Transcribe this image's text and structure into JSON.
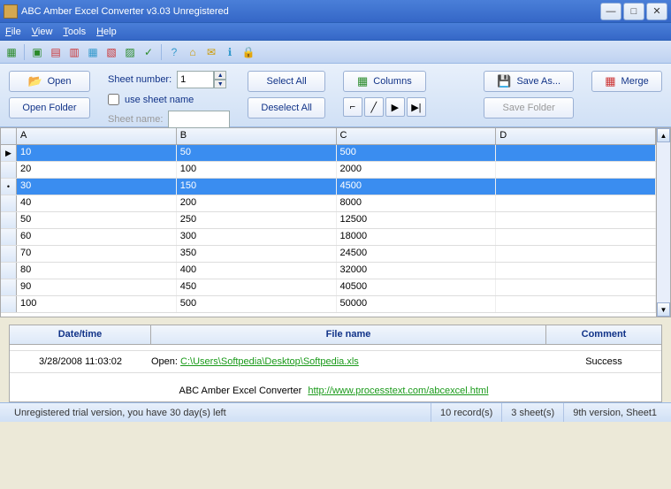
{
  "window": {
    "title": "ABC Amber Excel Converter v3.03 Unregistered"
  },
  "menu": {
    "file": "File",
    "view": "View",
    "tools": "Tools",
    "help": "Help"
  },
  "controls": {
    "open": "Open",
    "open_folder": "Open Folder",
    "sheet_number_label": "Sheet number:",
    "sheet_number_value": "1",
    "use_sheet_name_label": "use sheet name",
    "sheet_name_label": "Sheet name:",
    "sheet_name_value": "",
    "select_all": "Select All",
    "deselect_all": "Deselect All",
    "columns": "Columns",
    "save_as": "Save As...",
    "save_folder": "Save Folder",
    "merge": "Merge"
  },
  "grid": {
    "columns": [
      "A",
      "B",
      "C",
      "D"
    ],
    "rows": [
      {
        "a": "10",
        "b": "50",
        "c": "500",
        "d": "",
        "selected": true,
        "marker": "▶"
      },
      {
        "a": "20",
        "b": "100",
        "c": "2000",
        "d": "",
        "selected": false,
        "marker": ""
      },
      {
        "a": "30",
        "b": "150",
        "c": "4500",
        "d": "",
        "selected": true,
        "marker": "•"
      },
      {
        "a": "40",
        "b": "200",
        "c": "8000",
        "d": "",
        "selected": false,
        "marker": ""
      },
      {
        "a": "50",
        "b": "250",
        "c": "12500",
        "d": "",
        "selected": false,
        "marker": ""
      },
      {
        "a": "60",
        "b": "300",
        "c": "18000",
        "d": "",
        "selected": false,
        "marker": ""
      },
      {
        "a": "70",
        "b": "350",
        "c": "24500",
        "d": "",
        "selected": false,
        "marker": ""
      },
      {
        "a": "80",
        "b": "400",
        "c": "32000",
        "d": "",
        "selected": false,
        "marker": ""
      },
      {
        "a": "90",
        "b": "450",
        "c": "40500",
        "d": "",
        "selected": false,
        "marker": ""
      },
      {
        "a": "100",
        "b": "500",
        "c": "50000",
        "d": "",
        "selected": false,
        "marker": ""
      }
    ]
  },
  "log": {
    "headers": {
      "date": "Date/time",
      "file": "File name",
      "comment": "Comment"
    },
    "row": {
      "date": "3/28/2008 11:03:02",
      "action": "Open: ",
      "path": "C:\\Users\\Softpedia\\Desktop\\Softpedia.xls",
      "comment": "Success"
    }
  },
  "footer": {
    "product": "ABC Amber Excel Converter",
    "url": "http://www.processtext.com/abcexcel.html"
  },
  "status": {
    "trial": "Unregistered trial version, you have 30 day(s) left",
    "records": "10 record(s)",
    "sheets": "3 sheet(s)",
    "version": "9th version, Sheet1"
  }
}
